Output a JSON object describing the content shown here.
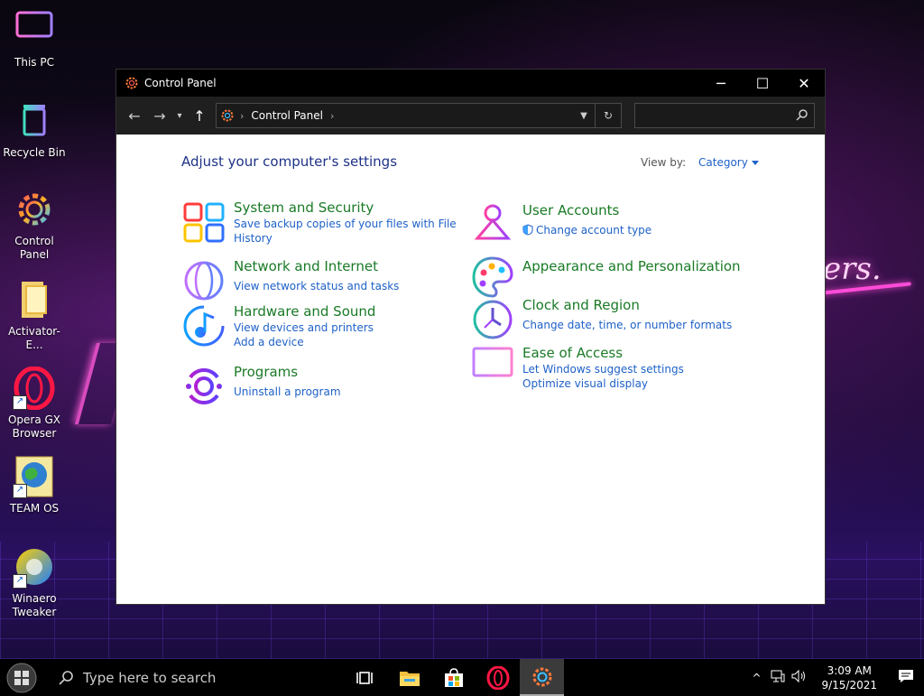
{
  "desktop": {
    "icons": [
      {
        "label": "This PC"
      },
      {
        "label": "Recycle Bin"
      },
      {
        "label": "Control Panel"
      },
      {
        "label": "Activator-E..."
      },
      {
        "label": "Opera GX Browser"
      },
      {
        "label": "TEAM OS"
      },
      {
        "label": "Winaero Tweaker"
      }
    ]
  },
  "window": {
    "title": "Control Panel",
    "controls": {
      "minimize": "─",
      "maximize": "☐",
      "close": "✕"
    },
    "address": {
      "crumb": "Control Panel",
      "separator": "›"
    },
    "search": {
      "placeholder": ""
    }
  },
  "content": {
    "heading": "Adjust your computer's settings",
    "view_by": {
      "label": "View by:",
      "value": "Category"
    },
    "categories": [
      {
        "title": "System and Security",
        "links": [
          "Save backup copies of your files with File",
          "History"
        ]
      },
      {
        "title": "Network and Internet",
        "links": [
          "View network status and tasks"
        ]
      },
      {
        "title": "Hardware and Sound",
        "links": [
          "View devices and printers",
          "Add a device"
        ]
      },
      {
        "title": "Programs",
        "links": [
          "Uninstall a program"
        ]
      },
      {
        "title": "User Accounts",
        "links": [
          "Change account type"
        ]
      },
      {
        "title": "Appearance and Personalization",
        "links": []
      },
      {
        "title": "Clock and Region",
        "links": [
          "Change date, time, or number formats"
        ]
      },
      {
        "title": "Ease of Access",
        "links": [
          "Let Windows suggest settings",
          "Optimize visual display"
        ]
      }
    ]
  },
  "taskbar": {
    "search_placeholder": "Type here to search",
    "time": "3:09 AM",
    "date": "9/15/2021"
  },
  "colors": {
    "title_green": "#1a7a26",
    "link_blue": "#1e61c8",
    "heading_blue": "#1e3287"
  }
}
